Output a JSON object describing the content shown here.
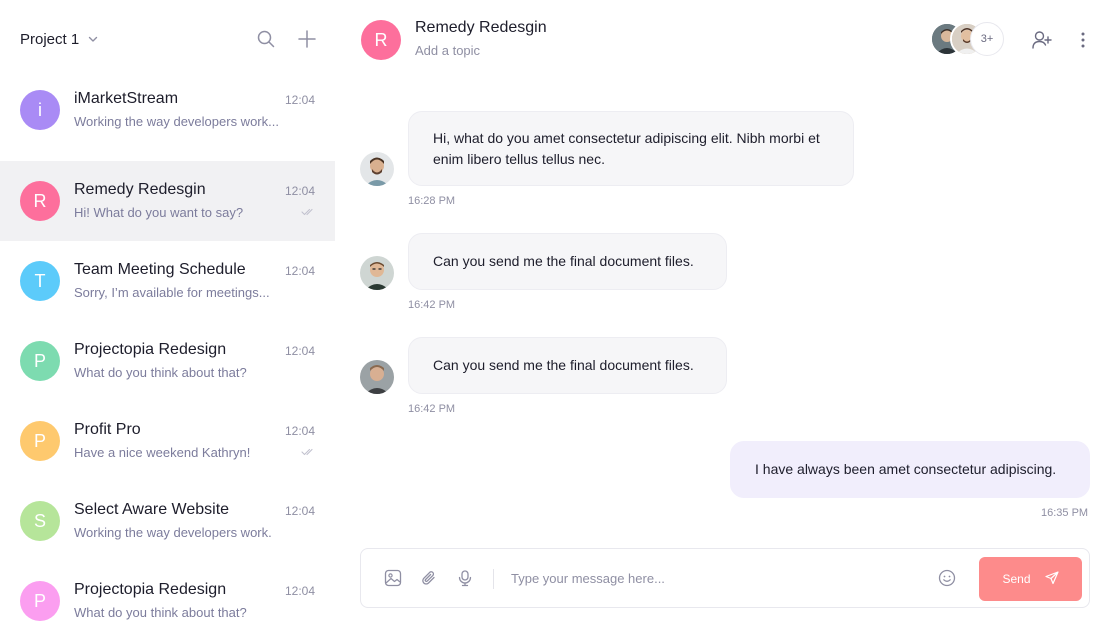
{
  "sidebar": {
    "project": "Project 1",
    "conversations": [
      {
        "initial": "i",
        "name": "iMarketStream",
        "time": "12:04",
        "preview": "Working the way developers work...",
        "color": "#a98bf5",
        "read": false
      },
      {
        "initial": "R",
        "name": "Remedy Redesgin",
        "time": "12:04",
        "preview": "Hi! What do you want to say?",
        "color": "#fd6f9c",
        "read": true
      },
      {
        "initial": "T",
        "name": "Team Meeting Schedule",
        "time": "12:04",
        "preview": "Sorry, I’m available for meetings...",
        "color": "#5ccbfa",
        "read": false
      },
      {
        "initial": "P",
        "name": "Projectopia Redesign",
        "time": "12:04",
        "preview": "What do you think about that?",
        "color": "#7ddbb0",
        "read": false
      },
      {
        "initial": "P",
        "name": "Profit Pro",
        "time": "12:04",
        "preview": "Have a nice weekend Kathryn!",
        "color": "#fec96e",
        "read": true
      },
      {
        "initial": "S",
        "name": "Select Aware Website",
        "time": "12:04",
        "preview": "Working the way developers work.",
        "color": "#b6e59a",
        "read": false
      },
      {
        "initial": "P",
        "name": "Projectopia Redesign",
        "time": "12:04",
        "preview": "What do you think about that?",
        "color": "#fb9ef0",
        "read": false
      }
    ]
  },
  "chat": {
    "initial": "R",
    "title": "Remedy Redesgin",
    "topic": "Add a topic",
    "members_more": "3+",
    "messages": [
      {
        "text": "Hi, what do you amet consectetur adipiscing elit. Nibh morbi et enim libero tellus tellus nec.",
        "time": "16:28 PM",
        "direction": "in"
      },
      {
        "text": "Can you send me the final document files.",
        "time": "16:42 PM",
        "direction": "in"
      },
      {
        "text": "Can you send me the final document files.",
        "time": "16:42 PM",
        "direction": "in"
      },
      {
        "text": "I have always been amet consectetur adipiscing.",
        "time": "16:35 PM",
        "direction": "out"
      }
    ]
  },
  "composer": {
    "placeholder": "Type your message here...",
    "send_label": "Send"
  },
  "colors": {
    "accent": "#fd8b8b",
    "active_row": "#f1f1f3",
    "incoming_bubble": "#f6f6f8",
    "outgoing_bubble": "#f1eefc"
  },
  "icons": [
    "chevron-down-icon",
    "search-icon",
    "plus-icon",
    "add-user-icon",
    "kebab-icon",
    "double-check-icon",
    "image-icon",
    "paperclip-icon",
    "microphone-icon",
    "emoji-icon",
    "send-icon"
  ]
}
